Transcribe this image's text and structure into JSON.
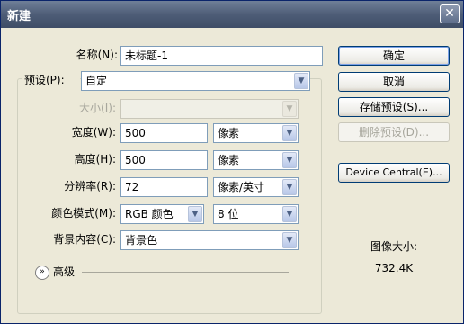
{
  "window": {
    "title": "新建",
    "close_symbol": "✕"
  },
  "form": {
    "name": {
      "label": "名称(N):",
      "value": "未标题-1"
    },
    "preset": {
      "label": "预设(P):",
      "value": "自定"
    },
    "size": {
      "label": "大小(I):",
      "value": ""
    },
    "width": {
      "label": "宽度(W):",
      "value": "500",
      "unit": "像素"
    },
    "height": {
      "label": "高度(H):",
      "value": "500",
      "unit": "像素"
    },
    "resolution": {
      "label": "分辨率(R):",
      "value": "72",
      "unit": "像素/英寸"
    },
    "color_mode": {
      "label": "颜色模式(M):",
      "value": "RGB 颜色",
      "depth": "8 位"
    },
    "background": {
      "label": "背景内容(C):",
      "value": "背景色"
    },
    "advanced": {
      "label": "高级",
      "icon": "chevron-down-double-icon"
    }
  },
  "buttons": {
    "ok": "确定",
    "cancel": "取消",
    "save_preset": "存储预设(S)...",
    "delete_preset": "删除预设(D)...",
    "device_central": "Device Central(E)..."
  },
  "image_size": {
    "label": "图像大小:",
    "value": "732.4K"
  },
  "colors": {
    "titlebar": "#4e5d77",
    "dialog_bg": "#ece9d8",
    "field_border": "#7f9db9"
  }
}
